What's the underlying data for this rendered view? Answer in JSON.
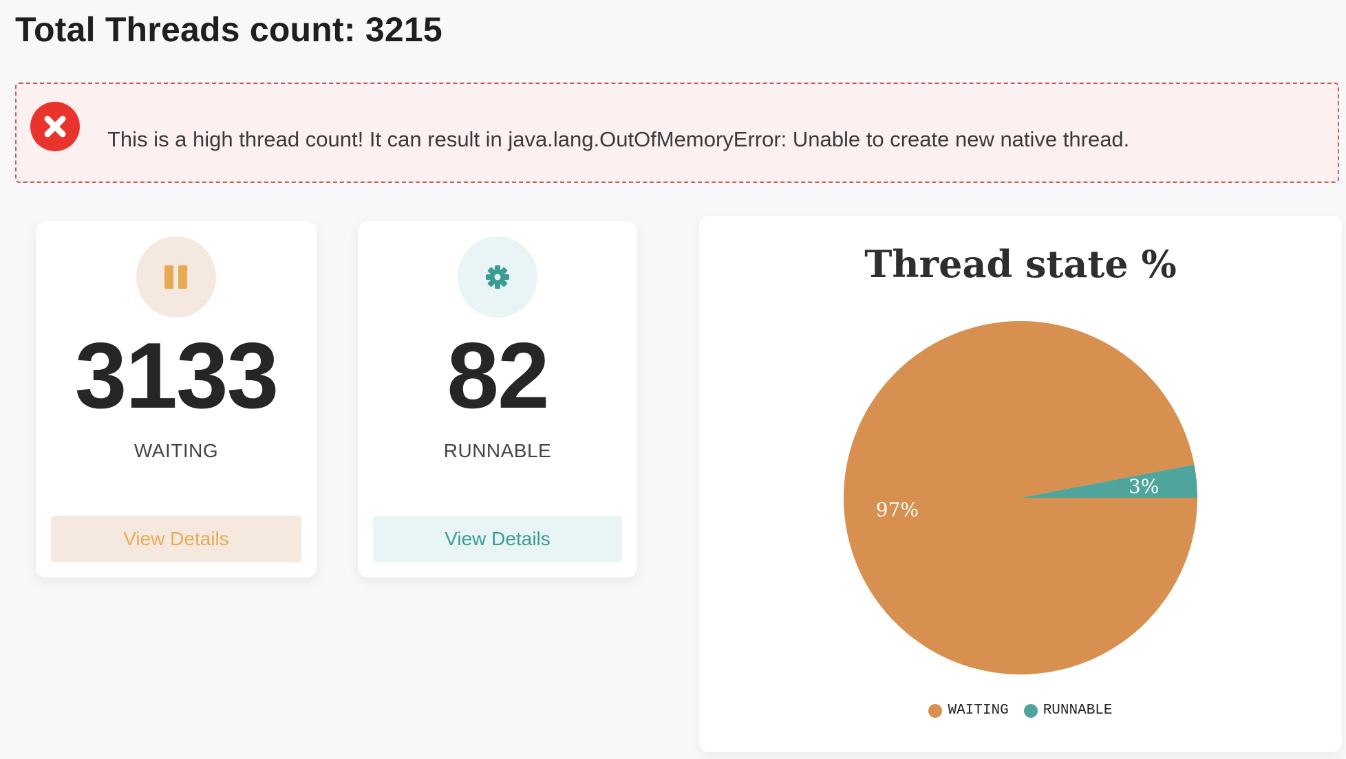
{
  "header": {
    "title": "Total Threads count: 3215"
  },
  "alert": {
    "icon": "error-x-icon",
    "message": "This is a high thread count! It can result in java.lang.OutOfMemoryError: Unable to create new native thread.",
    "icon_color": "#e8342c",
    "background": "#fdf0f0"
  },
  "cards": [
    {
      "icon": "pause-icon",
      "value": "3133",
      "label": "WAITING",
      "button_label": "View Details",
      "accent": "#e8a955",
      "icon_bg": "#f5e9df",
      "button_bg": "#f5e9df"
    },
    {
      "icon": "gear-icon",
      "value": "82",
      "label": "RUNNABLE",
      "button_label": "View Details",
      "accent": "#3a9c95",
      "icon_bg": "#e8f4f5",
      "button_bg": "#e8f4f5"
    }
  ],
  "chart_data": {
    "type": "pie",
    "title": "Thread state %",
    "labels": [
      "WAITING",
      "RUNNABLE"
    ],
    "values": [
      97,
      3
    ],
    "value_labels": [
      "97%",
      "3%"
    ],
    "colors": [
      "#d7904f",
      "#4fa59b"
    ],
    "legend_position": "bottom"
  }
}
